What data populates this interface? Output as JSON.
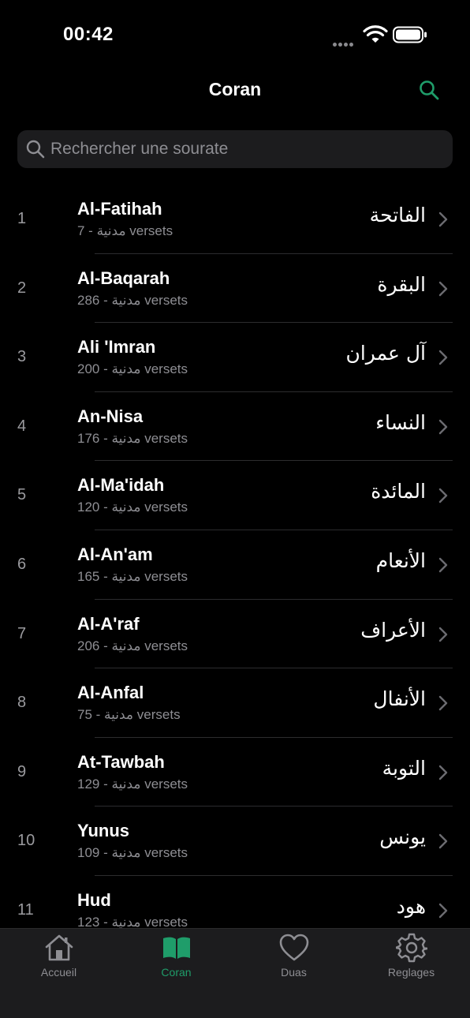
{
  "status_bar": {
    "time": "00:42"
  },
  "header": {
    "title": "Coran",
    "search_icon": "search-icon"
  },
  "search": {
    "placeholder": "Rechercher une sourate",
    "value": ""
  },
  "colors": {
    "accent": "#1f9d6a",
    "background": "#000000",
    "surface": "#1c1c1e",
    "secondary_text": "#8e8e93"
  },
  "surahs": [
    {
      "number": "1",
      "name": "Al-Fatihah",
      "subtitle": "7 - مدنية versets",
      "arabic": "الفاتحة"
    },
    {
      "number": "2",
      "name": "Al-Baqarah",
      "subtitle": "286 - مدنية versets",
      "arabic": "البقرة"
    },
    {
      "number": "3",
      "name": "Ali 'Imran",
      "subtitle": "200 - مدنية versets",
      "arabic": "آل عمران"
    },
    {
      "number": "4",
      "name": "An-Nisa",
      "subtitle": "176 - مدنية versets",
      "arabic": "النساء"
    },
    {
      "number": "5",
      "name": "Al-Ma'idah",
      "subtitle": "120 - مدنية versets",
      "arabic": "المائدة"
    },
    {
      "number": "6",
      "name": "Al-An'am",
      "subtitle": "165 - مدنية versets",
      "arabic": "الأنعام"
    },
    {
      "number": "7",
      "name": "Al-A'raf",
      "subtitle": "206 - مدنية versets",
      "arabic": "الأعراف"
    },
    {
      "number": "8",
      "name": "Al-Anfal",
      "subtitle": "75 - مدنية versets",
      "arabic": "الأنفال"
    },
    {
      "number": "9",
      "name": "At-Tawbah",
      "subtitle": "129 - مدنية versets",
      "arabic": "التوبة"
    },
    {
      "number": "10",
      "name": "Yunus",
      "subtitle": "109 - مدنية versets",
      "arabic": "يونس"
    },
    {
      "number": "11",
      "name": "Hud",
      "subtitle": "123 - مدنية versets",
      "arabic": "هود"
    }
  ],
  "tab_bar": {
    "tabs": [
      {
        "label": "Accueil",
        "icon": "home-icon",
        "active": false
      },
      {
        "label": "Coran",
        "icon": "book-icon",
        "active": true
      },
      {
        "label": "Duas",
        "icon": "heart-icon",
        "active": false
      },
      {
        "label": "Reglages",
        "icon": "gear-icon",
        "active": false
      }
    ]
  }
}
